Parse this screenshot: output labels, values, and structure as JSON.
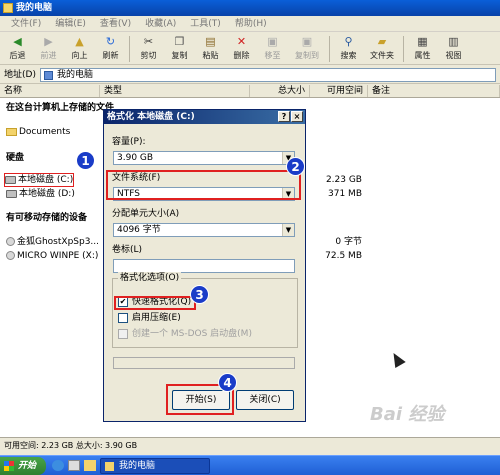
{
  "window": {
    "title": "我的电脑"
  },
  "menu": [
    "文件(F)",
    "编辑(E)",
    "查看(V)",
    "收藏(A)",
    "工具(T)",
    "帮助(H)"
  ],
  "toolbar": [
    {
      "label": "后退",
      "icon": "back-arrow-icon",
      "enabled": true
    },
    {
      "label": "前进",
      "icon": "forward-arrow-icon",
      "enabled": false
    },
    {
      "label": "向上",
      "icon": "up-folder-icon",
      "enabled": true
    },
    {
      "label": "刷新",
      "icon": "refresh-icon",
      "enabled": true
    },
    {
      "label": "剪切",
      "icon": "scissors-icon",
      "enabled": true
    },
    {
      "label": "复制",
      "icon": "copy-icon",
      "enabled": true
    },
    {
      "label": "粘贴",
      "icon": "paste-icon",
      "enabled": true
    },
    {
      "label": "删除",
      "icon": "delete-x-icon",
      "enabled": true
    },
    {
      "label": "移至",
      "icon": "move-to-icon",
      "enabled": false
    },
    {
      "label": "复制到",
      "icon": "copy-to-icon",
      "enabled": false
    },
    {
      "label": "搜索",
      "icon": "search-icon",
      "enabled": true
    },
    {
      "label": "文件夹",
      "icon": "folders-icon",
      "enabled": true
    },
    {
      "label": "属性",
      "icon": "properties-icon",
      "enabled": true
    },
    {
      "label": "视图",
      "icon": "views-icon",
      "enabled": true
    }
  ],
  "address": {
    "label": "地址(D)",
    "value": "我的电脑"
  },
  "columns": [
    "名称",
    "类型",
    "总大小",
    "可用空间",
    "备注"
  ],
  "groups": {
    "files": "在这台计算机上存储的文件",
    "hdd": "硬盘",
    "removable": "有可移动存储的设备"
  },
  "items": {
    "documents": "Documents",
    "driveC": {
      "name": "本地磁盘 (C:)",
      "free": "2.23 GB"
    },
    "driveD": {
      "name": "本地磁盘 (D:)",
      "free": "371 MB"
    },
    "cd1": {
      "name": "金狐GhostXpSp3...",
      "free": "0 字节"
    },
    "cd2": {
      "name": "MICRO WINPE (X:)",
      "free": "72.5 MB"
    }
  },
  "status": "可用空间: 2.23 GB 总大小: 3.90 GB",
  "taskbar": {
    "start": "开始",
    "task": "我的电脑"
  },
  "dialog": {
    "title": "格式化 本地磁盘 (C:)",
    "capacity_label": "容量(P):",
    "capacity_value": "3.90 GB",
    "fs_label": "文件系统(F)",
    "fs_value": "NTFS",
    "alloc_label": "分配单元大小(A)",
    "alloc_value": "4096 字节",
    "volume_label": "卷标(L)",
    "options_label": "格式化选项(O)",
    "quick_format": "快速格式化(Q)",
    "compress": "启用压缩(E)",
    "msdos": "创建一个 MS-DOS 启动盘(M)",
    "start_button": "开始(S)",
    "close_button": "关闭(C)"
  },
  "callouts": [
    "1",
    "2",
    "3",
    "4"
  ],
  "watermark": "Bai 经验"
}
